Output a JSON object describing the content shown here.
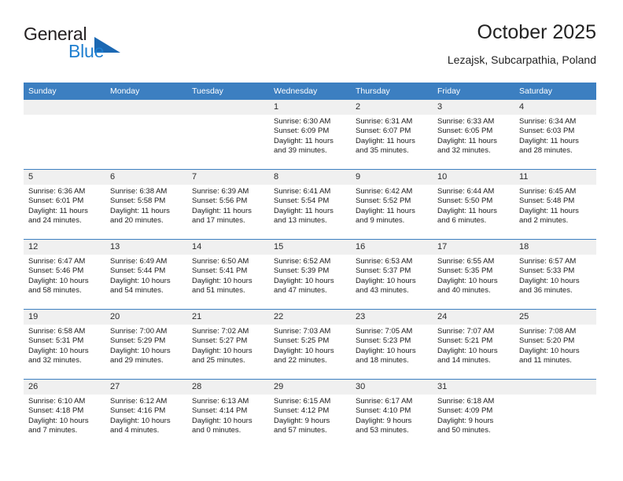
{
  "brand": {
    "name_top": "General",
    "name_bottom": "Blue",
    "accent_color": "#1b68b3",
    "triangle_icon": "brand-triangle-icon"
  },
  "header": {
    "title": "October 2025",
    "subtitle": "Lezajsk, Subcarpathia, Poland"
  },
  "calendar": {
    "header_bg": "#3c7fc1",
    "daynum_bg": "#f0f0f0",
    "weekday_headers": [
      "Sunday",
      "Monday",
      "Tuesday",
      "Wednesday",
      "Thursday",
      "Friday",
      "Saturday"
    ],
    "weeks": [
      [
        {
          "day": "",
          "empty": true,
          "sunrise": "",
          "sunset": "",
          "daylight_line1": "",
          "daylight_line2": ""
        },
        {
          "day": "",
          "empty": true,
          "sunrise": "",
          "sunset": "",
          "daylight_line1": "",
          "daylight_line2": ""
        },
        {
          "day": "",
          "empty": true,
          "sunrise": "",
          "sunset": "",
          "daylight_line1": "",
          "daylight_line2": ""
        },
        {
          "day": "1",
          "empty": false,
          "sunrise": "Sunrise: 6:30 AM",
          "sunset": "Sunset: 6:09 PM",
          "daylight_line1": "Daylight: 11 hours",
          "daylight_line2": "and 39 minutes."
        },
        {
          "day": "2",
          "empty": false,
          "sunrise": "Sunrise: 6:31 AM",
          "sunset": "Sunset: 6:07 PM",
          "daylight_line1": "Daylight: 11 hours",
          "daylight_line2": "and 35 minutes."
        },
        {
          "day": "3",
          "empty": false,
          "sunrise": "Sunrise: 6:33 AM",
          "sunset": "Sunset: 6:05 PM",
          "daylight_line1": "Daylight: 11 hours",
          "daylight_line2": "and 32 minutes."
        },
        {
          "day": "4",
          "empty": false,
          "sunrise": "Sunrise: 6:34 AM",
          "sunset": "Sunset: 6:03 PM",
          "daylight_line1": "Daylight: 11 hours",
          "daylight_line2": "and 28 minutes."
        }
      ],
      [
        {
          "day": "5",
          "empty": false,
          "sunrise": "Sunrise: 6:36 AM",
          "sunset": "Sunset: 6:01 PM",
          "daylight_line1": "Daylight: 11 hours",
          "daylight_line2": "and 24 minutes."
        },
        {
          "day": "6",
          "empty": false,
          "sunrise": "Sunrise: 6:38 AM",
          "sunset": "Sunset: 5:58 PM",
          "daylight_line1": "Daylight: 11 hours",
          "daylight_line2": "and 20 minutes."
        },
        {
          "day": "7",
          "empty": false,
          "sunrise": "Sunrise: 6:39 AM",
          "sunset": "Sunset: 5:56 PM",
          "daylight_line1": "Daylight: 11 hours",
          "daylight_line2": "and 17 minutes."
        },
        {
          "day": "8",
          "empty": false,
          "sunrise": "Sunrise: 6:41 AM",
          "sunset": "Sunset: 5:54 PM",
          "daylight_line1": "Daylight: 11 hours",
          "daylight_line2": "and 13 minutes."
        },
        {
          "day": "9",
          "empty": false,
          "sunrise": "Sunrise: 6:42 AM",
          "sunset": "Sunset: 5:52 PM",
          "daylight_line1": "Daylight: 11 hours",
          "daylight_line2": "and 9 minutes."
        },
        {
          "day": "10",
          "empty": false,
          "sunrise": "Sunrise: 6:44 AM",
          "sunset": "Sunset: 5:50 PM",
          "daylight_line1": "Daylight: 11 hours",
          "daylight_line2": "and 6 minutes."
        },
        {
          "day": "11",
          "empty": false,
          "sunrise": "Sunrise: 6:45 AM",
          "sunset": "Sunset: 5:48 PM",
          "daylight_line1": "Daylight: 11 hours",
          "daylight_line2": "and 2 minutes."
        }
      ],
      [
        {
          "day": "12",
          "empty": false,
          "sunrise": "Sunrise: 6:47 AM",
          "sunset": "Sunset: 5:46 PM",
          "daylight_line1": "Daylight: 10 hours",
          "daylight_line2": "and 58 minutes."
        },
        {
          "day": "13",
          "empty": false,
          "sunrise": "Sunrise: 6:49 AM",
          "sunset": "Sunset: 5:44 PM",
          "daylight_line1": "Daylight: 10 hours",
          "daylight_line2": "and 54 minutes."
        },
        {
          "day": "14",
          "empty": false,
          "sunrise": "Sunrise: 6:50 AM",
          "sunset": "Sunset: 5:41 PM",
          "daylight_line1": "Daylight: 10 hours",
          "daylight_line2": "and 51 minutes."
        },
        {
          "day": "15",
          "empty": false,
          "sunrise": "Sunrise: 6:52 AM",
          "sunset": "Sunset: 5:39 PM",
          "daylight_line1": "Daylight: 10 hours",
          "daylight_line2": "and 47 minutes."
        },
        {
          "day": "16",
          "empty": false,
          "sunrise": "Sunrise: 6:53 AM",
          "sunset": "Sunset: 5:37 PM",
          "daylight_line1": "Daylight: 10 hours",
          "daylight_line2": "and 43 minutes."
        },
        {
          "day": "17",
          "empty": false,
          "sunrise": "Sunrise: 6:55 AM",
          "sunset": "Sunset: 5:35 PM",
          "daylight_line1": "Daylight: 10 hours",
          "daylight_line2": "and 40 minutes."
        },
        {
          "day": "18",
          "empty": false,
          "sunrise": "Sunrise: 6:57 AM",
          "sunset": "Sunset: 5:33 PM",
          "daylight_line1": "Daylight: 10 hours",
          "daylight_line2": "and 36 minutes."
        }
      ],
      [
        {
          "day": "19",
          "empty": false,
          "sunrise": "Sunrise: 6:58 AM",
          "sunset": "Sunset: 5:31 PM",
          "daylight_line1": "Daylight: 10 hours",
          "daylight_line2": "and 32 minutes."
        },
        {
          "day": "20",
          "empty": false,
          "sunrise": "Sunrise: 7:00 AM",
          "sunset": "Sunset: 5:29 PM",
          "daylight_line1": "Daylight: 10 hours",
          "daylight_line2": "and 29 minutes."
        },
        {
          "day": "21",
          "empty": false,
          "sunrise": "Sunrise: 7:02 AM",
          "sunset": "Sunset: 5:27 PM",
          "daylight_line1": "Daylight: 10 hours",
          "daylight_line2": "and 25 minutes."
        },
        {
          "day": "22",
          "empty": false,
          "sunrise": "Sunrise: 7:03 AM",
          "sunset": "Sunset: 5:25 PM",
          "daylight_line1": "Daylight: 10 hours",
          "daylight_line2": "and 22 minutes."
        },
        {
          "day": "23",
          "empty": false,
          "sunrise": "Sunrise: 7:05 AM",
          "sunset": "Sunset: 5:23 PM",
          "daylight_line1": "Daylight: 10 hours",
          "daylight_line2": "and 18 minutes."
        },
        {
          "day": "24",
          "empty": false,
          "sunrise": "Sunrise: 7:07 AM",
          "sunset": "Sunset: 5:21 PM",
          "daylight_line1": "Daylight: 10 hours",
          "daylight_line2": "and 14 minutes."
        },
        {
          "day": "25",
          "empty": false,
          "sunrise": "Sunrise: 7:08 AM",
          "sunset": "Sunset: 5:20 PM",
          "daylight_line1": "Daylight: 10 hours",
          "daylight_line2": "and 11 minutes."
        }
      ],
      [
        {
          "day": "26",
          "empty": false,
          "sunrise": "Sunrise: 6:10 AM",
          "sunset": "Sunset: 4:18 PM",
          "daylight_line1": "Daylight: 10 hours",
          "daylight_line2": "and 7 minutes."
        },
        {
          "day": "27",
          "empty": false,
          "sunrise": "Sunrise: 6:12 AM",
          "sunset": "Sunset: 4:16 PM",
          "daylight_line1": "Daylight: 10 hours",
          "daylight_line2": "and 4 minutes."
        },
        {
          "day": "28",
          "empty": false,
          "sunrise": "Sunrise: 6:13 AM",
          "sunset": "Sunset: 4:14 PM",
          "daylight_line1": "Daylight: 10 hours",
          "daylight_line2": "and 0 minutes."
        },
        {
          "day": "29",
          "empty": false,
          "sunrise": "Sunrise: 6:15 AM",
          "sunset": "Sunset: 4:12 PM",
          "daylight_line1": "Daylight: 9 hours",
          "daylight_line2": "and 57 minutes."
        },
        {
          "day": "30",
          "empty": false,
          "sunrise": "Sunrise: 6:17 AM",
          "sunset": "Sunset: 4:10 PM",
          "daylight_line1": "Daylight: 9 hours",
          "daylight_line2": "and 53 minutes."
        },
        {
          "day": "31",
          "empty": false,
          "sunrise": "Sunrise: 6:18 AM",
          "sunset": "Sunset: 4:09 PM",
          "daylight_line1": "Daylight: 9 hours",
          "daylight_line2": "and 50 minutes."
        },
        {
          "day": "",
          "empty": true,
          "sunrise": "",
          "sunset": "",
          "daylight_line1": "",
          "daylight_line2": ""
        }
      ]
    ]
  }
}
